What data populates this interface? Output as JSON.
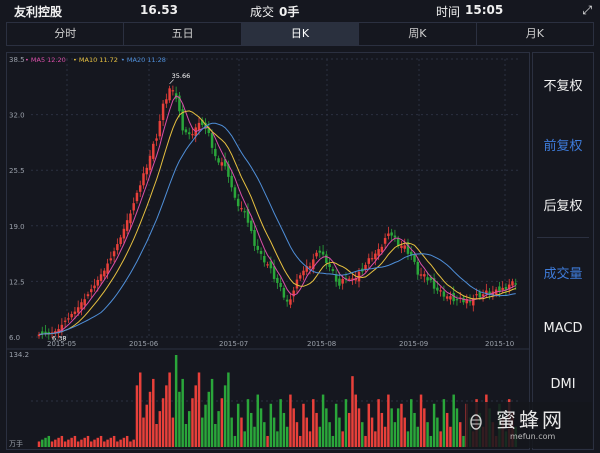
{
  "header": {
    "name": "友利控股",
    "price": "16.53",
    "volume_label": "成交",
    "volume_value": "0手",
    "time_label": "时间",
    "time_value": "15:05"
  },
  "tabs": [
    {
      "label": "分时",
      "active": false
    },
    {
      "label": "五日",
      "active": false
    },
    {
      "label": "日K",
      "active": true
    },
    {
      "label": "周K",
      "active": false
    },
    {
      "label": "月K",
      "active": false
    }
  ],
  "side_menu": {
    "items": [
      {
        "label": "不复权",
        "color": "#f0f0f0"
      },
      {
        "label": "前复权",
        "color": "#3e7bd9"
      },
      {
        "label": "后复权",
        "color": "#f0f0f0"
      },
      {
        "label": "成交量",
        "color": "#3e7bd9"
      },
      {
        "label": "MACD",
        "color": "#f0f0f0"
      },
      {
        "label": "DMI",
        "color": "#f0f0f0"
      }
    ]
  },
  "colors": {
    "up": "#e8403a",
    "down": "#2aa63a",
    "ma5": "#d94ea8",
    "ma10": "#e6c040",
    "ma20": "#4f8fd9",
    "grid": "#2b3040",
    "axis_text": "#9aa0aa"
  },
  "watermark": {
    "text": "蜜蜂网",
    "url": "mefun.com"
  },
  "chart_data": {
    "type": "candlestick",
    "legend": [
      {
        "label": "MA5 12.20",
        "color": "#d94ea8"
      },
      {
        "label": "MA10 11.72",
        "color": "#e6c040"
      },
      {
        "label": "MA20 11.28",
        "color": "#4f8fd9"
      }
    ],
    "y_ticks": [
      "38.5",
      "32.0",
      "25.5",
      "19.0",
      "12.5",
      "6.0"
    ],
    "ylim": [
      6.0,
      38.5
    ],
    "x_ticks": [
      "2015-05",
      "2015-06",
      "2015-07",
      "2015-08",
      "2015-09",
      "2015-10"
    ],
    "max_label": "35.66",
    "min_label": "6.38",
    "volume_max_label": "134.2",
    "volume_unit_label": "万手",
    "anchors": [
      {
        "i": 0,
        "v": 6.4
      },
      {
        "i": 2,
        "v": 6.4
      },
      {
        "i": 5,
        "v": 6.6
      },
      {
        "i": 8,
        "v": 7.8
      },
      {
        "i": 12,
        "v": 9.5
      },
      {
        "i": 16,
        "v": 11.5
      },
      {
        "i": 20,
        "v": 13.8
      },
      {
        "i": 24,
        "v": 16.8
      },
      {
        "i": 28,
        "v": 20.5
      },
      {
        "i": 32,
        "v": 25.0
      },
      {
        "i": 36,
        "v": 29.5
      },
      {
        "i": 38,
        "v": 33.0
      },
      {
        "i": 40,
        "v": 35.0
      },
      {
        "i": 42,
        "v": 34.0
      },
      {
        "i": 44,
        "v": 30.5
      },
      {
        "i": 46,
        "v": 29.5
      },
      {
        "i": 48,
        "v": 30.5
      },
      {
        "i": 50,
        "v": 31.0
      },
      {
        "i": 52,
        "v": 29.5
      },
      {
        "i": 54,
        "v": 27.0
      },
      {
        "i": 56,
        "v": 26.5
      },
      {
        "i": 58,
        "v": 25.0
      },
      {
        "i": 60,
        "v": 22.0
      },
      {
        "i": 62,
        "v": 21.0
      },
      {
        "i": 64,
        "v": 19.5
      },
      {
        "i": 66,
        "v": 17.0
      },
      {
        "i": 68,
        "v": 15.5
      },
      {
        "i": 70,
        "v": 14.5
      },
      {
        "i": 72,
        "v": 13.0
      },
      {
        "i": 74,
        "v": 11.5
      },
      {
        "i": 76,
        "v": 10.0
      },
      {
        "i": 78,
        "v": 11.5
      },
      {
        "i": 80,
        "v": 13.5
      },
      {
        "i": 82,
        "v": 14.0
      },
      {
        "i": 84,
        "v": 15.0
      },
      {
        "i": 86,
        "v": 16.0
      },
      {
        "i": 88,
        "v": 15.0
      },
      {
        "i": 90,
        "v": 13.5
      },
      {
        "i": 92,
        "v": 12.0
      },
      {
        "i": 94,
        "v": 13.0
      },
      {
        "i": 96,
        "v": 12.5
      },
      {
        "i": 98,
        "v": 13.5
      },
      {
        "i": 100,
        "v": 14.5
      },
      {
        "i": 102,
        "v": 15.5
      },
      {
        "i": 104,
        "v": 16.0
      },
      {
        "i": 106,
        "v": 17.5
      },
      {
        "i": 108,
        "v": 18.0
      },
      {
        "i": 110,
        "v": 17.0
      },
      {
        "i": 112,
        "v": 16.5
      },
      {
        "i": 114,
        "v": 15.5
      },
      {
        "i": 116,
        "v": 13.5
      },
      {
        "i": 118,
        "v": 13.0
      },
      {
        "i": 120,
        "v": 12.5
      },
      {
        "i": 122,
        "v": 11.5
      },
      {
        "i": 124,
        "v": 11.0
      },
      {
        "i": 126,
        "v": 10.5
      },
      {
        "i": 128,
        "v": 10.3
      },
      {
        "i": 130,
        "v": 10.2
      },
      {
        "i": 132,
        "v": 10.4
      },
      {
        "i": 134,
        "v": 10.8
      },
      {
        "i": 136,
        "v": 11.0
      },
      {
        "i": 138,
        "v": 11.3
      },
      {
        "i": 140,
        "v": 11.2
      },
      {
        "i": 142,
        "v": 11.6
      },
      {
        "i": 144,
        "v": 12.2
      },
      {
        "i": 146,
        "v": 12.4
      }
    ],
    "count": 147
  }
}
